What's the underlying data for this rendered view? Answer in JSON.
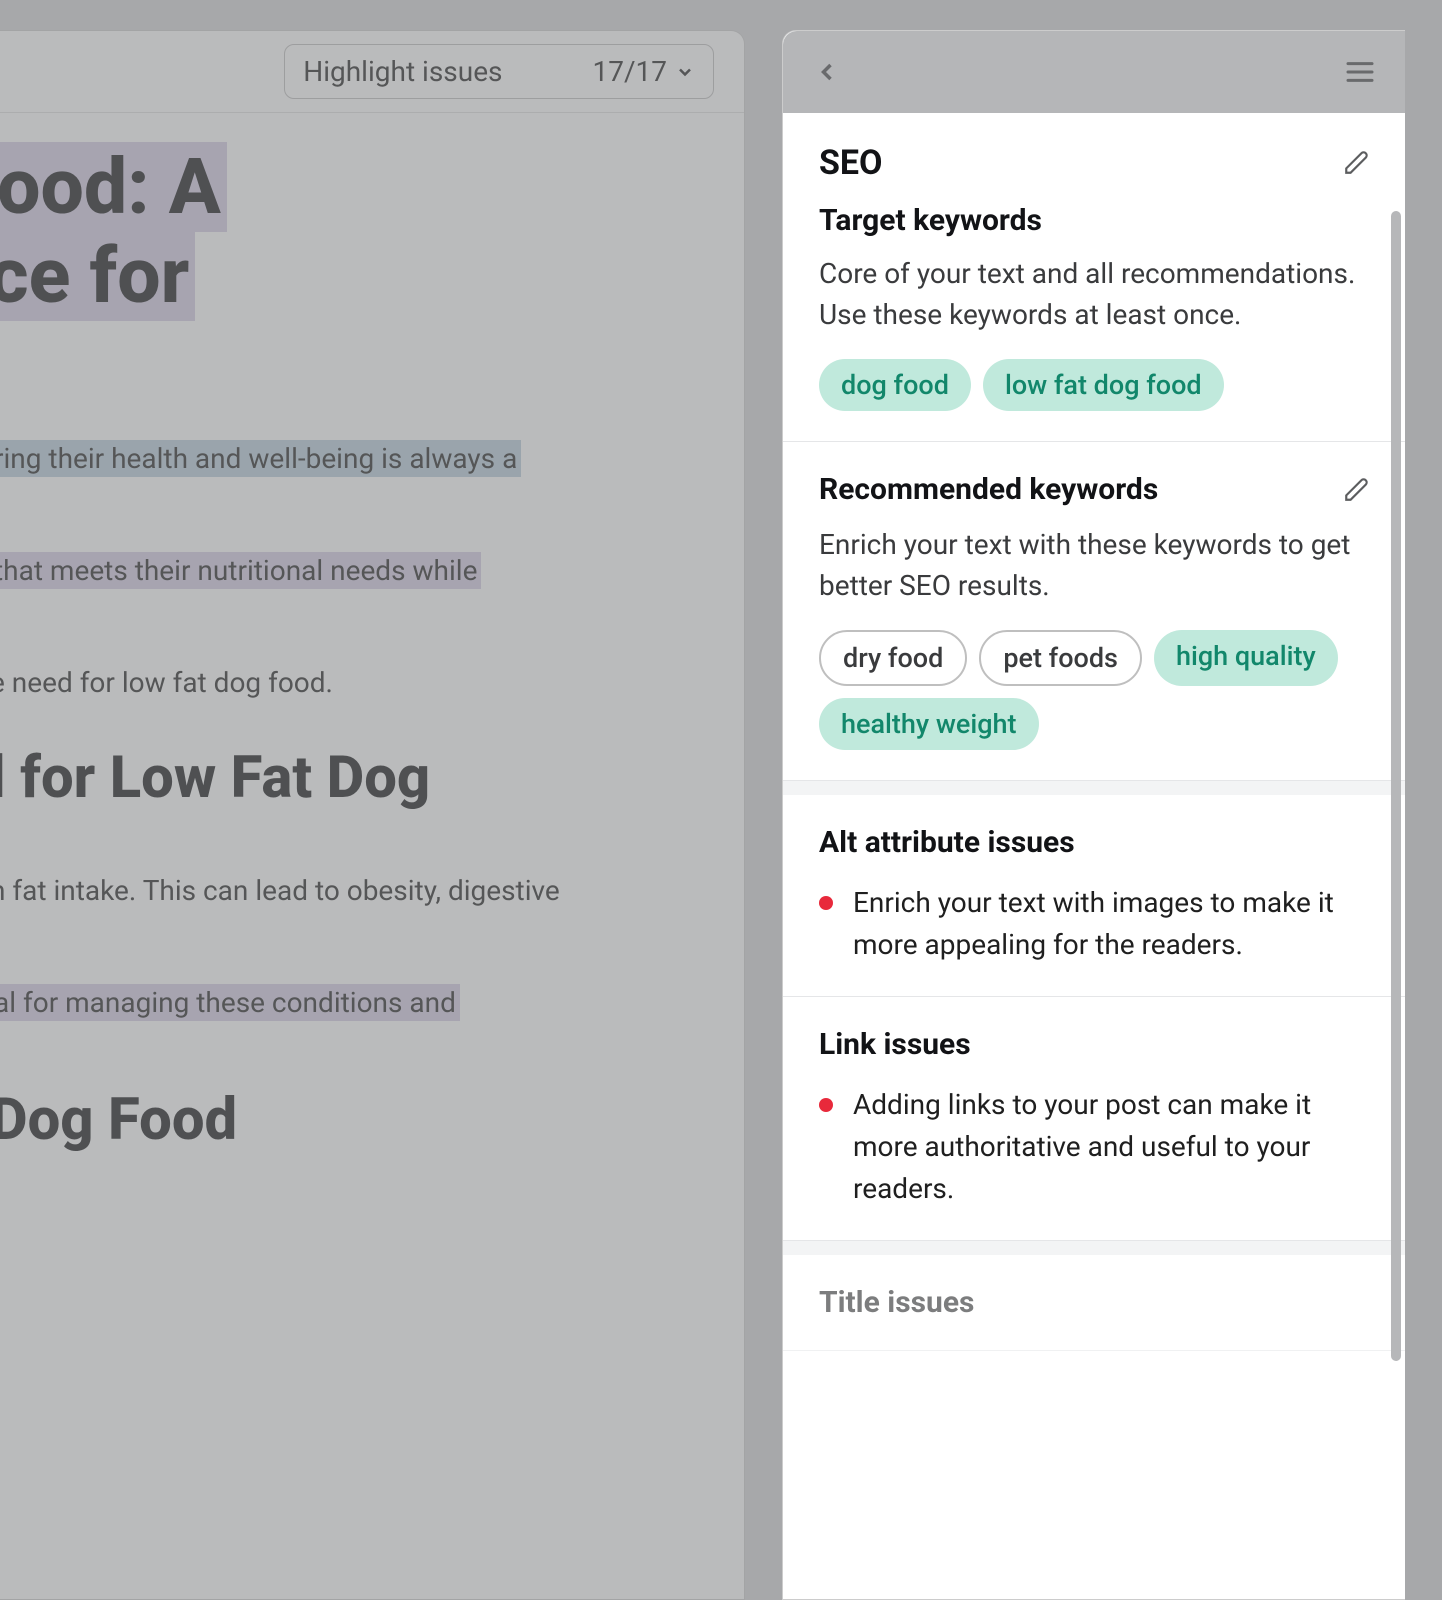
{
  "toolbar": {
    "highlight_label": "Highlight issues",
    "highlight_count": "17/17"
  },
  "article": {
    "title_part1": "Dog Food: A",
    "title_part2": "Choice for",
    "para1": "ring their health and well-being is always a",
    "para2": "that meets their nutritional needs while",
    "para3": "e need for low fat dog food.",
    "h2a": "l for Low Fat Dog",
    "para4": "n fat intake. This can lead to obesity, digestive",
    "para5": "al for managing these conditions and",
    "h2b": "Dog Food"
  },
  "sidebar": {
    "seo_title": "SEO",
    "target_keywords": {
      "title": "Target keywords",
      "desc": "Core of your text and all recommendations. Use these keywords at least once.",
      "pills": [
        "dog food",
        "low fat dog food"
      ]
    },
    "recommended_keywords": {
      "title": "Recommended keywords",
      "desc": "Enrich your text with these keywords to get better SEO results.",
      "pills_outline": [
        "dry food",
        "pet foods"
      ],
      "pills_teal": [
        "high quality",
        "healthy weight"
      ]
    },
    "alt_issues": {
      "title": "Alt attribute issues",
      "item": "Enrich your text with images to make it more appealing for the readers."
    },
    "link_issues": {
      "title": "Link issues",
      "item": "Adding links to your post can make it more authoritative and useful to your readers."
    },
    "title_issues": {
      "title": "Title issues"
    }
  }
}
